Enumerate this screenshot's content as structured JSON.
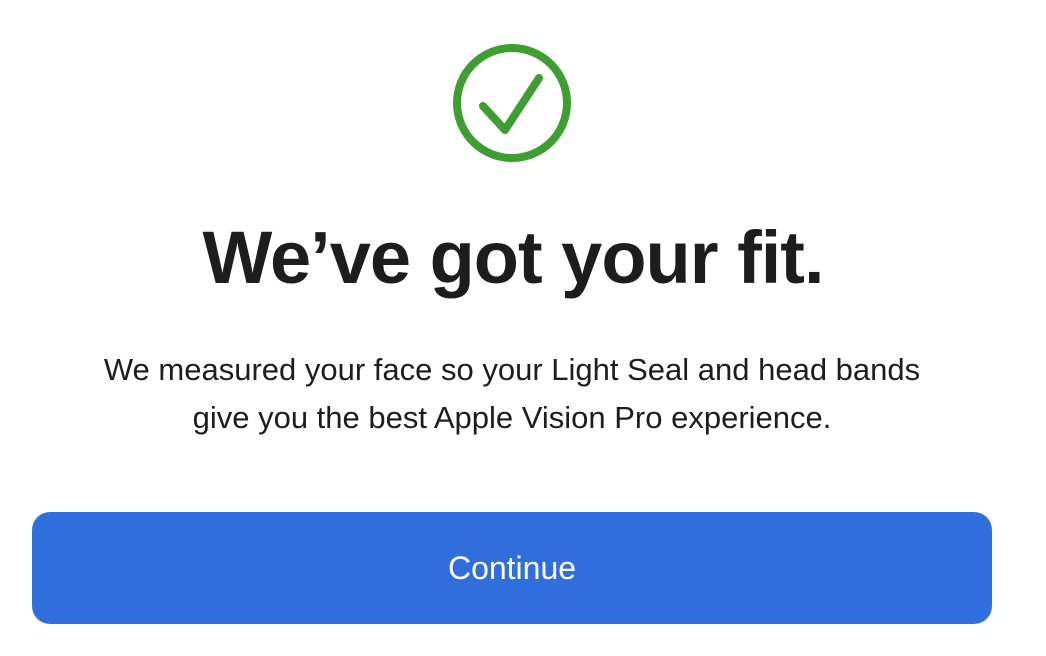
{
  "status": {
    "icon": "checkmark-circle-icon",
    "color": "#3f9e31"
  },
  "heading": {
    "title": "We’ve got your fit."
  },
  "body": {
    "line1": "We measured your face so your Light Seal and head bands",
    "line2": "give you the best Apple Vision Pro experience."
  },
  "actions": {
    "continue_label": "Continue",
    "continue_color": "#306fdb"
  }
}
